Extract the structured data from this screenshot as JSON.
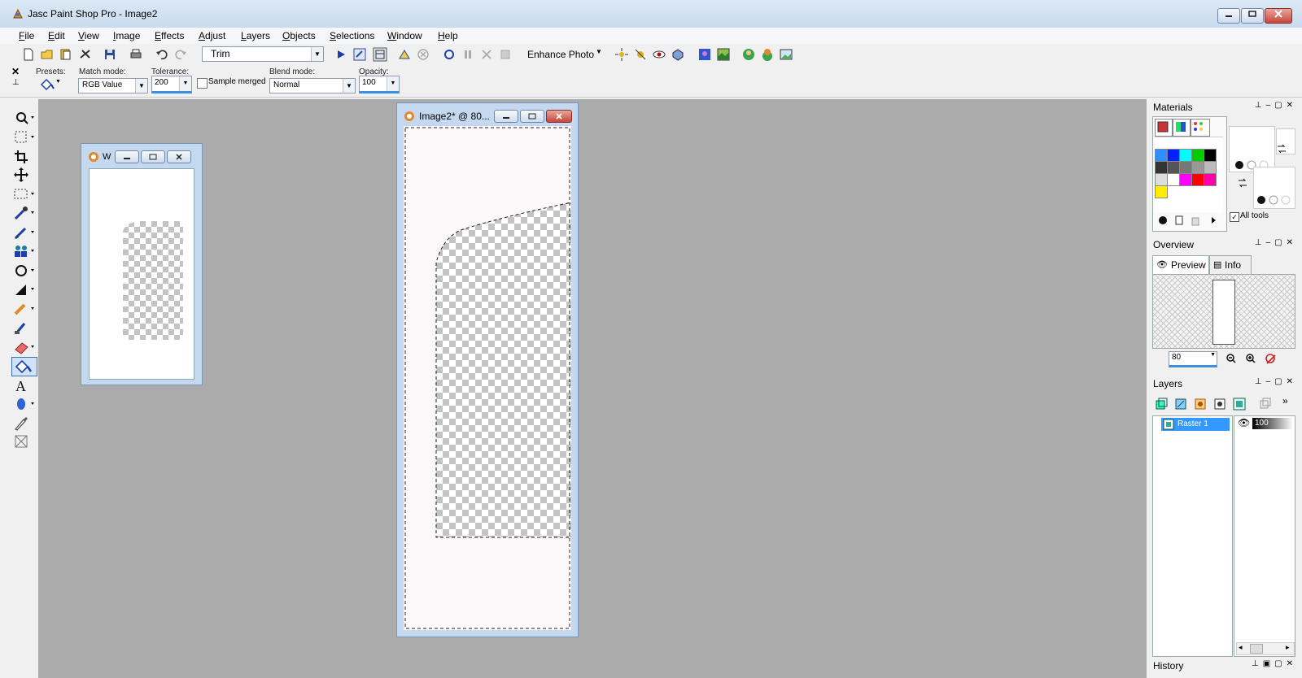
{
  "window": {
    "title": "Jasc Paint Shop Pro - Image2"
  },
  "menu": [
    "File",
    "Edit",
    "View",
    "Image",
    "Effects",
    "Adjust",
    "Layers",
    "Objects",
    "Selections",
    "Window",
    "Help"
  ],
  "toolbar": {
    "script_value": "Trim",
    "enhance_label": "Enhance Photo"
  },
  "options": {
    "presets_label": "Presets:",
    "match_mode_label": "Match mode:",
    "match_mode_value": "RGB Value",
    "tolerance_label": "Tolerance:",
    "tolerance_value": "200",
    "sample_merged_label": "Sample merged",
    "blend_mode_label": "Blend mode:",
    "blend_mode_value": "Normal",
    "opacity_label": "Opacity:",
    "opacity_value": "100"
  },
  "small_window": {
    "title": "W"
  },
  "image_window": {
    "title": "Image2* @  80..."
  },
  "materials": {
    "title": "Materials",
    "all_tools_label": "All tools"
  },
  "overview": {
    "title": "Overview",
    "tab_preview": "Preview",
    "tab_info": "Info",
    "zoom_value": "80"
  },
  "layers": {
    "title": "Layers",
    "layer_name": "Raster 1",
    "layer_opacity": "100"
  },
  "history": {
    "title": "History"
  },
  "colors": {
    "palette": [
      "#2f8fff",
      "#0022ff",
      "#00ffff",
      "#00cc00",
      "#000000",
      "#333333",
      "#555555",
      "#777777",
      "#999999",
      "#bbbbbb",
      "#dddddd",
      "#ffffff",
      "#ff00ff",
      "#ff0000",
      "#ff00aa",
      "#ffee00"
    ]
  }
}
